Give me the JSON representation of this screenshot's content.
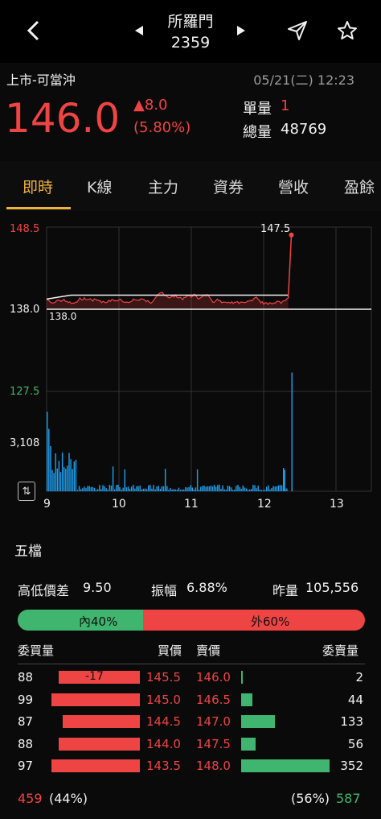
{
  "header": {
    "stock_name": "所羅門",
    "stock_code": "2359"
  },
  "quote": {
    "market": "上市-可當沖",
    "datetime": "05/21(二) 12:23",
    "price": "146.0",
    "change": "8.0",
    "change_pct": "(5.80%)",
    "unit_vol_label": "單量",
    "unit_vol": "1",
    "total_vol_label": "總量",
    "total_vol": "48769"
  },
  "tabs": [
    "即時",
    "K線",
    "主力",
    "資券",
    "營收",
    "盈餘"
  ],
  "chart_data": {
    "type": "line",
    "price_axis": {
      "max": "148.5",
      "ref": "138.0",
      "min": "127.5"
    },
    "ref_price_label": "138.0",
    "high_label": "147.5",
    "volume_axis_max": "3,108",
    "x_ticks": [
      "9",
      "10",
      "11",
      "12",
      "13"
    ],
    "price_range": [
      127.5,
      148.5
    ],
    "volume_max": 3108
  },
  "five_levels": {
    "title": "五檔",
    "spread_label": "高低價差",
    "spread": "9.50",
    "amplitude_label": "振幅",
    "amplitude": "6.88%",
    "prev_vol_label": "昨量",
    "prev_vol": "105,556",
    "inner": "內40%",
    "outer": "外60%",
    "inner_pct": 0.4,
    "headers": {
      "bid_qty": "委買量",
      "bid_price": "買價",
      "ask_price": "賣價",
      "ask_qty": "委賣量"
    },
    "rows": [
      {
        "bid_qty": "88",
        "bid_change": "-17",
        "bid_price": "145.5",
        "ask_price": "146.0",
        "ask_qty": "2",
        "bid_ratio": 0.23,
        "ask_ratio": 0.006
      },
      {
        "bid_qty": "99",
        "bid_change": "",
        "bid_price": "145.0",
        "ask_price": "146.5",
        "ask_qty": "44",
        "bid_ratio": 0.25,
        "ask_ratio": 0.13
      },
      {
        "bid_qty": "87",
        "bid_change": "",
        "bid_price": "144.5",
        "ask_price": "147.0",
        "ask_qty": "133",
        "bid_ratio": 0.22,
        "ask_ratio": 0.38
      },
      {
        "bid_qty": "88",
        "bid_change": "",
        "bid_price": "144.0",
        "ask_price": "147.5",
        "ask_qty": "56",
        "bid_ratio": 0.23,
        "ask_ratio": 0.16
      },
      {
        "bid_qty": "97",
        "bid_change": "",
        "bid_price": "143.5",
        "ask_price": "148.0",
        "ask_qty": "352",
        "bid_ratio": 0.25,
        "ask_ratio": 1.0
      }
    ],
    "total_bid": "459",
    "total_bid_pct": "(44%)",
    "total_ask_pct": "(56%)",
    "total_ask": "587"
  },
  "colors": {
    "up": "#ef4444",
    "down": "#3fb56f",
    "accent": "#f0b23a"
  }
}
